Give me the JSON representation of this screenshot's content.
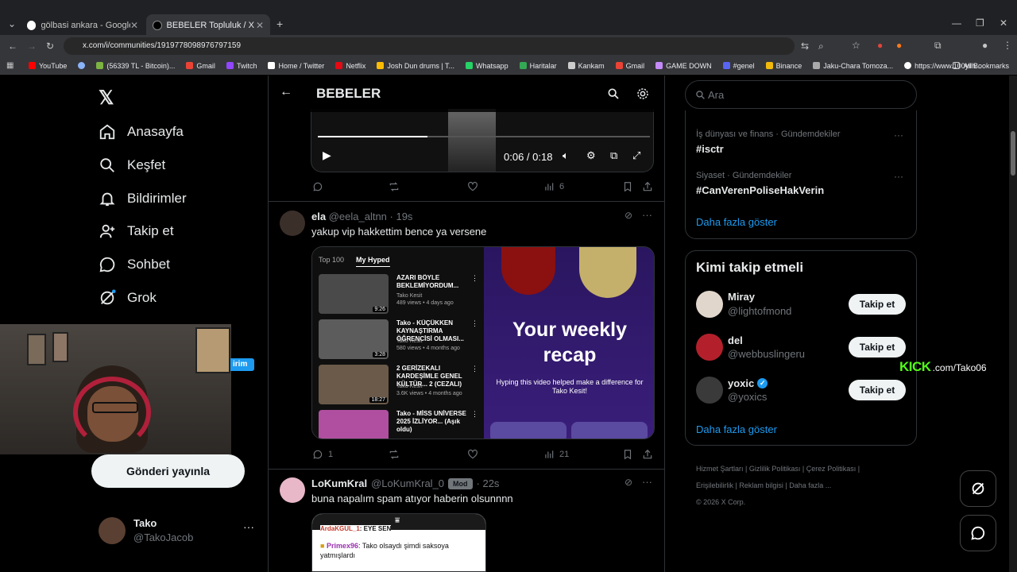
{
  "browser": {
    "tabs": [
      {
        "title": "gölbasi ankara - Google'da Ara"
      },
      {
        "title": "BEBELER Topluluk / X"
      }
    ],
    "url": "x.com/i/communities/1919778098976797159",
    "bookmarks": [
      "YouTube",
      "(56339 TL - Bitcoin)...",
      "Gmail",
      "Twitch",
      "Home / Twitter",
      "Netflix",
      "Josh Dun drums | T...",
      "Whatsapp",
      "Haritalar",
      "Kankam",
      "Gmail",
      "GAME DOWN",
      "#genel",
      "Binance",
      "Jaku-Chara Tomoza...",
      "https://www.100yilh..."
    ],
    "all_bookmarks": "All Bookmarks"
  },
  "nav": {
    "home": "Anasayfa",
    "explore": "Keşfet",
    "notifications": "Bildirimler",
    "follow": "Takip et",
    "chat": "Sohbet",
    "grok": "Grok",
    "post_button": "Gönderi yayınla",
    "partial_label": "irim"
  },
  "account": {
    "name": "Tako",
    "handle": "@TakoJacob"
  },
  "community": {
    "title": "BEBELER"
  },
  "video_post": {
    "time": "0:06 / 0:18",
    "views": "6"
  },
  "post1": {
    "name": "ela",
    "handle": "@eela_altnn",
    "time": "· 19s",
    "text": "yakup vip hakkettim bence ya versene",
    "replies": "1",
    "views": "21",
    "media": {
      "tabs": [
        "Top 100",
        "My Hyped"
      ],
      "videos": [
        {
          "title": "AZARI BÖYLE BEKLEMİYORDUM...",
          "channel": "Tako Kesit",
          "meta": "489 views • 4 days ago",
          "duration": "9:26"
        },
        {
          "title": "Tako - KÜÇÜKKEN KAYNAŞTIRMA ÖĞRENCİSİ OLMASI...",
          "channel": "Tako Kesit",
          "meta": "580 views • 4 months ago",
          "duration": "3:28"
        },
        {
          "title": "2 GERİZEKALI KARDEŞİMLE GENEL KÜLTÜR... 2 (CEZALI)",
          "channel": "Tako Kesit",
          "meta": "3.6K views • 4 months ago",
          "duration": "18:27"
        },
        {
          "title": "Tako - MİSS UNİVERSE 2025 İZLİYOR... (Aşık oldu)",
          "channel": "",
          "meta": "",
          "duration": ""
        }
      ],
      "recap_title": "Your weekly recap",
      "recap_sub": "Hyping this video helped make a difference for Tako Kesit!"
    }
  },
  "post2": {
    "name": "LoKumKral",
    "handle": "@LoKumKral_0",
    "badge": "Mod",
    "time": "· 22s",
    "text": "buna napalım spam atıyor haberin olsunnnn",
    "chat": [
      {
        "user": "ArdaKGUL_1",
        "msg": ": EYE SEN"
      },
      {
        "user": "Primex96",
        "msg": ": Tako olsaydı şimdi saksoya yatmışlardı"
      }
    ]
  },
  "search": {
    "placeholder": "Ara"
  },
  "trends": [
    {
      "category": "İş dünyası ve finans · Gündemdekiler",
      "tag": "#isctr"
    },
    {
      "category": "Siyaset · Gündemdekiler",
      "tag": "#CanVerenPoliseHakVerin"
    }
  ],
  "show_more": "Daha fazla göster",
  "who_to_follow": {
    "title": "Kimi takip etmeli",
    "users": [
      {
        "name": "Miray",
        "handle": "@lightofmond",
        "button": "Takip et"
      },
      {
        "name": "del",
        "handle": "@webbuslingeru",
        "button": "Takip et"
      },
      {
        "name": "yoxic",
        "handle": "@yoxics",
        "button": "Takip et"
      }
    ],
    "show_more": "Daha fazla göster"
  },
  "footer": {
    "links": [
      "Hizmet Şartları",
      "Gizlilik Politikası",
      "Çerez Politikası",
      "Erişilebilirlik",
      "Reklam bilgisi",
      "Daha fazla ..."
    ],
    "copyright": "© 2026 X Corp."
  },
  "overlay": {
    "kick": "KICK",
    "kick_url": ".com/Tako06"
  },
  "colors": {
    "accent": "#1d9bf0",
    "kick": "#53fc18",
    "background": "#000000"
  }
}
